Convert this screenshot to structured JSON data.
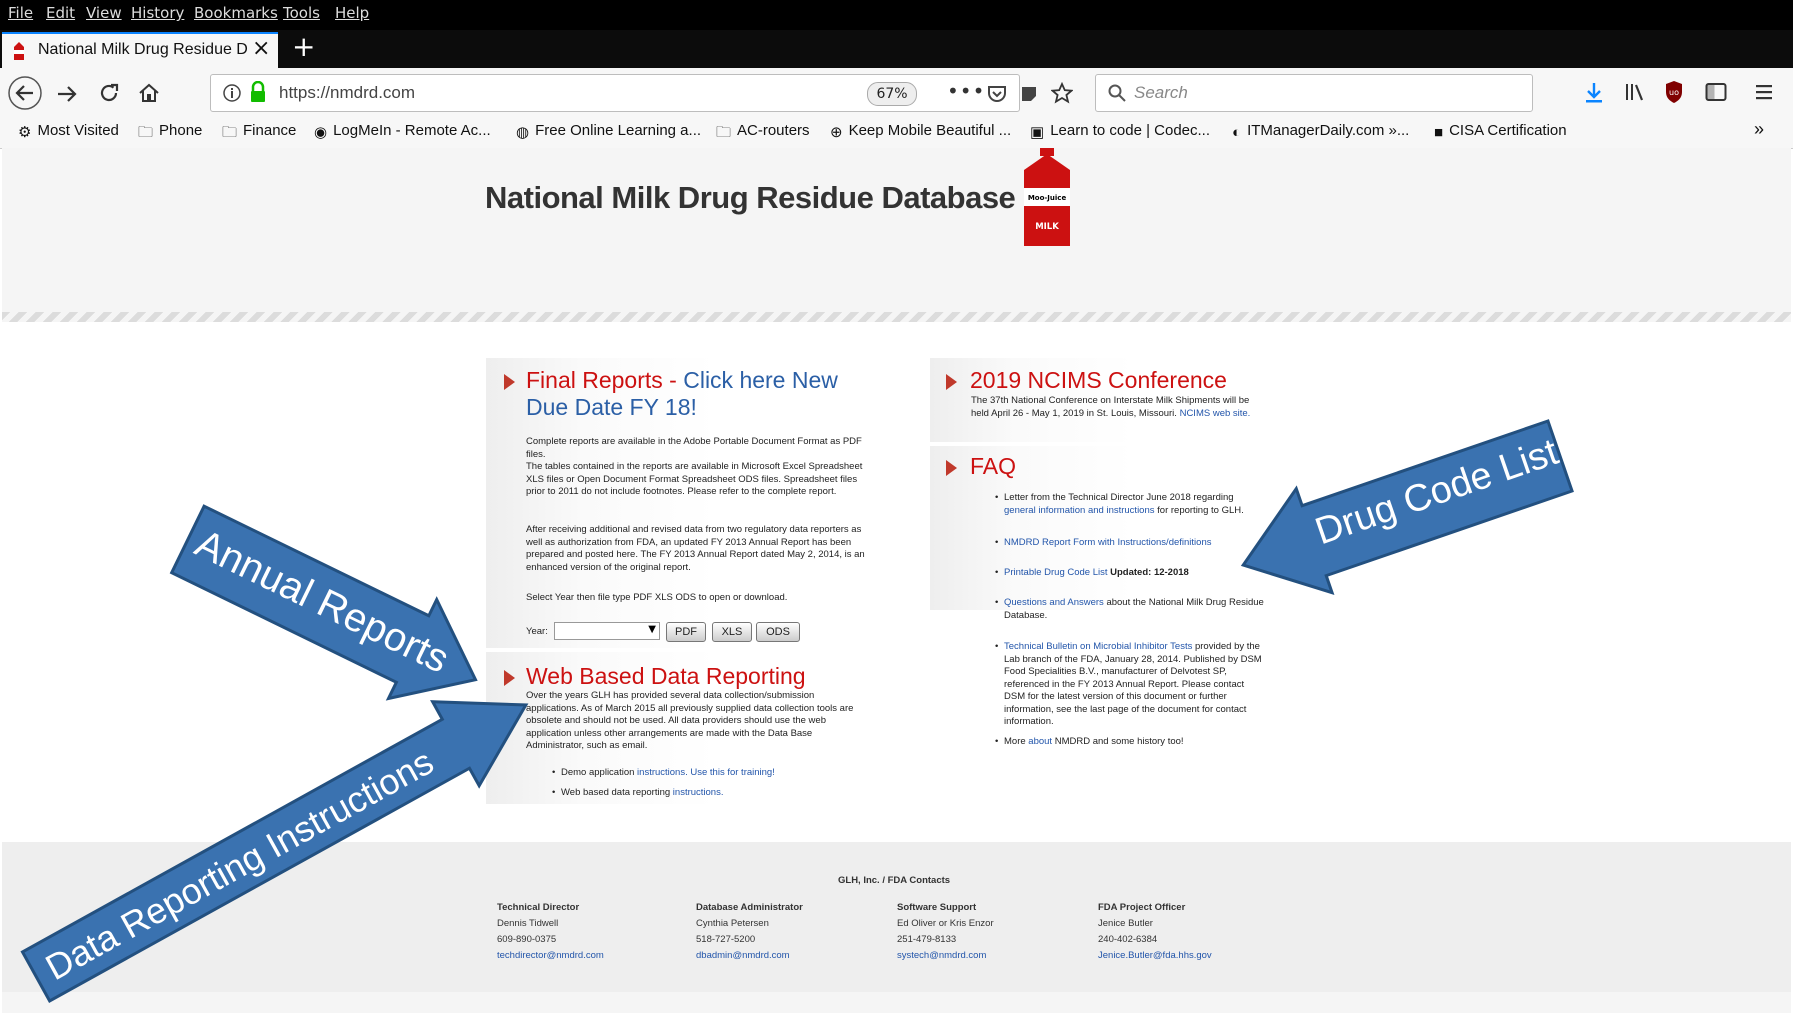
{
  "menubar": {
    "items": [
      "File",
      "Edit",
      "View",
      "History",
      "Bookmarks",
      "Tools",
      "Help"
    ]
  },
  "tab": {
    "title": "National Milk Drug Residue Dat"
  },
  "navbar": {
    "url": "https://nmdrd.com",
    "zoom": "67%",
    "search_placeholder": "Search"
  },
  "bookmarks": [
    "Most Visited",
    "Phone",
    "Finance",
    "LogMeIn - Remote Ac...",
    "Free Online Learning a...",
    "AC-routers",
    "Keep Mobile Beautiful ...",
    "Learn to code | Codec...",
    "ITManagerDaily.com »...",
    "CISA Certification"
  ],
  "header": {
    "title": "National Milk Drug Residue Database",
    "carton_brand": "Moo-Juice",
    "carton_label": "MILK"
  },
  "final_reports": {
    "title_red": "Final Reports - ",
    "title_blue_1": "Click here New",
    "title_blue_2": "Due Date FY 18!",
    "p1": "Complete reports are available in the Adobe Portable Document Format as PDF files.",
    "p2": "The tables contained in the reports are available in Microsoft Excel Spreadsheet XLS files or Open Document Format Spreadsheet ODS files. Spreadsheet files prior to 2011 do not include footnotes. Please refer to the complete report.",
    "p3": "After receiving additional and revised data from two regulatory data reporters as well as authorization from FDA, an updated FY 2013 Annual Report has been prepared and posted here. The FY 2013 Annual Report dated May 2, 2014, is an enhanced version of the original report.",
    "p4": "Select Year then file type PDF XLS ODS to open or download.",
    "year_label": "Year:",
    "btn_pdf": "PDF",
    "btn_xls": "XLS",
    "btn_ods": "ODS"
  },
  "web_reporting": {
    "title": "Web Based Data Reporting",
    "p1": "Over the years GLH has provided several data collection/submission applications.  As of March 2015 all previously supplied data collection tools are obsolete and should not be used.  All data providers should use the web application unless other arrangements are made with the Data Base Administrator, such as email.",
    "li1_text": "Demo application ",
    "li1_link": "instructions. Use this for training!",
    "li2_text": "Web based data reporting ",
    "li2_link": "instructions."
  },
  "conference": {
    "title": "2019 NCIMS Conference",
    "text": "The 37th National Conference on Interstate Milk Shipments will be held April 26 - May 1, 2019 in St. Louis, Missouri. ",
    "link": "NCIMS web site."
  },
  "faq": {
    "title": "FAQ",
    "i1_text": "Letter from the Technical Director June 2018 regarding ",
    "i1_link": "general information and instructions",
    "i1_tail": " for reporting to GLH.",
    "i2_link": "NMDRD Report Form with Instructions/definitions",
    "i3_link": "Printable Drug Code List",
    "i3_tail": " Updated: 12-2018",
    "i4_link": "Questions and Answers",
    "i4_tail": " about the National Milk Drug Residue Database.",
    "i5_link": "Technical Bulletin on Microbial Inhibitor Tests",
    "i5_tail": " provided by the Lab branch of the FDA, January 28, 2014. Published by DSM Food Specialities B.V., manufacturer of Delvotest SP, referenced in the FY 2013 Annual Report. Please contact DSM for the latest version of this document or further information, see the last page of the document for contact information.",
    "i6_text": "More ",
    "i6_link": "about",
    "i6_tail": " NMDRD and some history too!"
  },
  "footer": {
    "heading": "GLH, Inc. / FDA Contacts",
    "contacts": [
      {
        "role": "Technical Director",
        "name": "Dennis Tidwell",
        "phone": "609-890-0375",
        "email": "techdirector@nmdrd.com"
      },
      {
        "role": "Database Administrator",
        "name": "Cynthia Petersen",
        "phone": "518-727-5200",
        "email": "dbadmin@nmdrd.com"
      },
      {
        "role": "Software Support",
        "name": "Ed Oliver or Kris Enzor",
        "phone": "251-479-8133",
        "email": "systech@nmdrd.com"
      },
      {
        "role": "FDA Project Officer",
        "name": "Jenice Butler",
        "phone": "240-402-6384",
        "email": "Jenice.Butler@fda.hhs.gov"
      }
    ]
  },
  "callouts": {
    "annual_reports": "Annual Reports",
    "drug_code_list": "Drug Code List",
    "data_reporting": "Data Reporting Instructions"
  },
  "colors": {
    "callout_fill": "#3a72b0",
    "title_red": "#cc1111",
    "title_blue": "#2b5fa6",
    "link": "#2255aa"
  }
}
